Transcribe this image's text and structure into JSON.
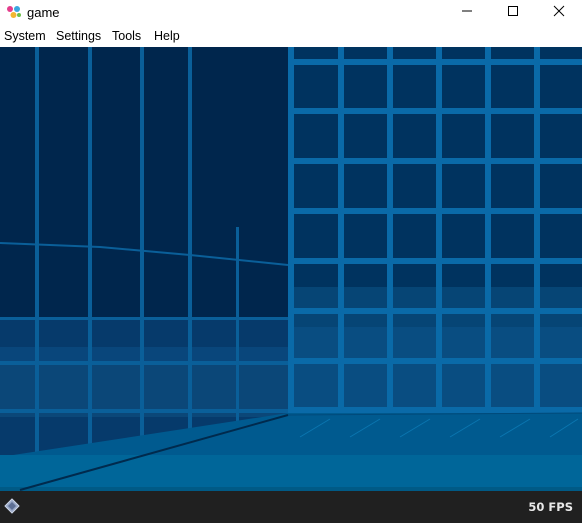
{
  "window": {
    "title": "game",
    "icon": "emulator-logo-icon",
    "controls": [
      "minimize-icon",
      "maximize-icon",
      "close-icon"
    ]
  },
  "menu": {
    "items": [
      {
        "label": "System"
      },
      {
        "label": "Settings"
      },
      {
        "label": "Tools"
      },
      {
        "label": "Help"
      }
    ]
  },
  "status": {
    "fps": "50 FPS",
    "icon": "diamond-logo-icon"
  },
  "colors": {
    "game_bg_dark": "#00264d",
    "game_grid": "#0a5f99",
    "game_floor": "#006699",
    "status_bg": "#202020"
  }
}
